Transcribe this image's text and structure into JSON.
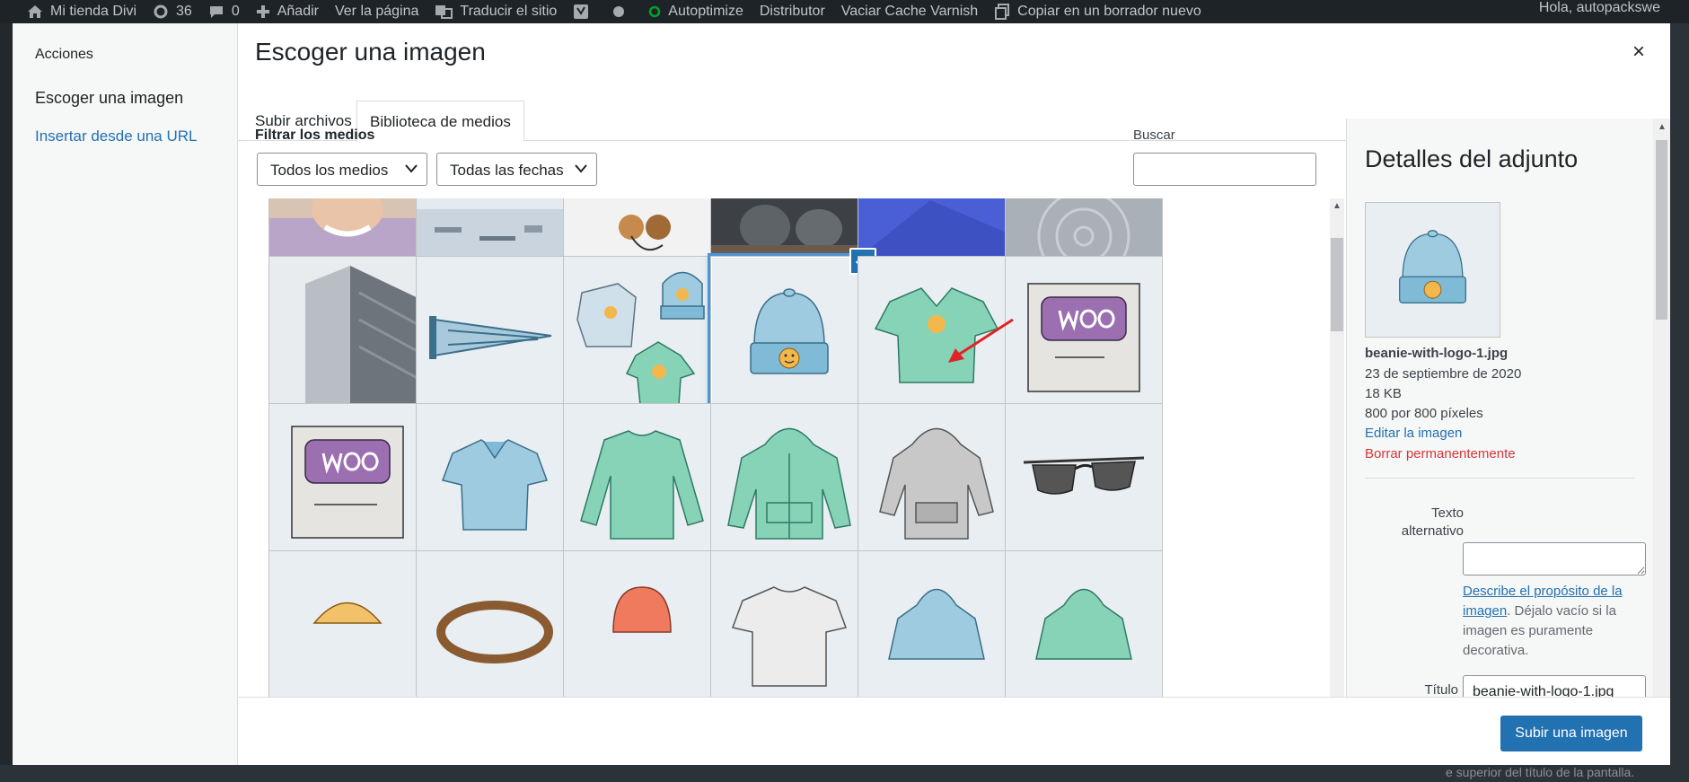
{
  "adminbar": {
    "site_name": "Mi tienda Divi",
    "updates_count": "36",
    "comments_count": "0",
    "new_label": "Añadir",
    "view_page": "Ver la página",
    "translate": "Traducir el sitio",
    "autoptimize": "Autoptimize",
    "distributor": "Distributor",
    "varnish": "Vaciar Cache Varnish",
    "copy_draft": "Copiar en un borrador nuevo",
    "greeting": "Hola, autopackswe"
  },
  "modal": {
    "title": "Escoger una imagen",
    "close_glyph": "×",
    "menu": {
      "heading": "Acciones",
      "items": [
        {
          "label": "Escoger una imagen"
        },
        {
          "label": "Insertar desde una URL"
        }
      ]
    },
    "tabs": [
      {
        "label": "Subir archivos"
      },
      {
        "label": "Biblioteca de medios"
      }
    ],
    "filters": {
      "label": "Filtrar los medios",
      "type_select": "Todos los medios",
      "date_select": "Todas las fechas"
    },
    "search": {
      "label": "Buscar",
      "value": ""
    },
    "footer": {
      "button": "Subir una imagen"
    }
  },
  "attachment": {
    "heading": "Detalles del adjunto",
    "filename": "beanie-with-logo-1.jpg",
    "date": "23 de septiembre de 2020",
    "size": "18 KB",
    "dimensions": "800 por 800 píxeles",
    "edit_link": "Editar la imagen",
    "delete_link": "Borrar permanentemente",
    "alt_label": "Texto alternativo",
    "alt_value": "",
    "alt_help_link": "Describe el propósito de la imagen",
    "alt_help_text": ". Déjalo vacío si la imagen es puramente decorativa.",
    "title_label": "Título",
    "title_value": "beanie-with-logo-1.jpg"
  },
  "bottom_text": "e superior del título de la pantalla.",
  "colors": {
    "accent": "#2271b1",
    "delete": "#d63638",
    "admin_bar": "#1d2327",
    "arrow": "#e02424"
  }
}
